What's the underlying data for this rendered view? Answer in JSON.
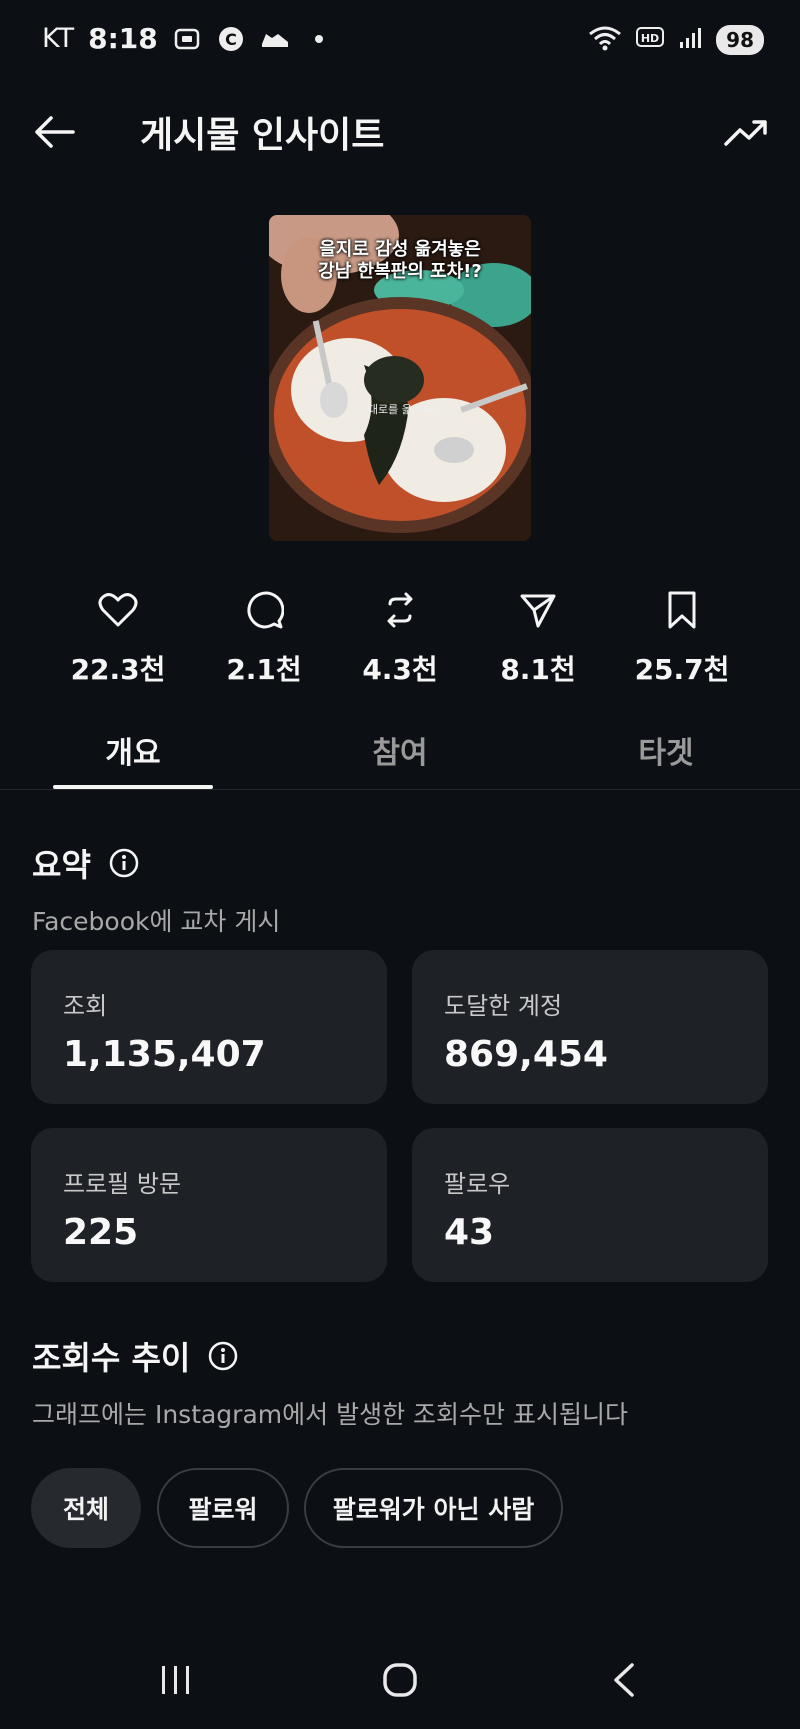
{
  "status_bar": {
    "carrier": "KT",
    "time": "8:18",
    "battery": "98",
    "icons": [
      "screenshot-icon",
      "c-icon",
      "sneaker-icon",
      "dot-icon",
      "wifi-icon",
      "hd-icon",
      "signal-icon"
    ]
  },
  "header": {
    "title": "게시물 인사이트",
    "back_icon": "arrow-left-icon",
    "trend_icon": "trending-up-icon"
  },
  "thumbnail": {
    "caption_line1": "을지로 감성 옮겨놓은",
    "caption_line2": "강남 한복판의 포차!?",
    "subtitle": "그대로를 옮겨놓은"
  },
  "metrics": [
    {
      "icon": "heart-icon",
      "value": "22.3천"
    },
    {
      "icon": "comment-icon",
      "value": "2.1천"
    },
    {
      "icon": "repost-icon",
      "value": "4.3천"
    },
    {
      "icon": "share-icon",
      "value": "8.1천"
    },
    {
      "icon": "bookmark-icon",
      "value": "25.7천"
    }
  ],
  "tabs": [
    {
      "label": "개요",
      "active": true
    },
    {
      "label": "참여",
      "active": false
    },
    {
      "label": "타겟",
      "active": false
    }
  ],
  "summary": {
    "title": "요약",
    "subtitle": "Facebook에 교차 게시",
    "cards": [
      {
        "label": "조회",
        "value": "1,135,407"
      },
      {
        "label": "도달한 계정",
        "value": "869,454"
      },
      {
        "label": "프로필 방문",
        "value": "225"
      },
      {
        "label": "팔로우",
        "value": "43"
      }
    ]
  },
  "views_trend": {
    "title": "조회수 추이",
    "subtitle": "그래프에는 Instagram에서 발생한 조회수만 표시됩니다",
    "filters": [
      {
        "label": "전체",
        "selected": true
      },
      {
        "label": "팔로워",
        "selected": false
      },
      {
        "label": "팔로워가 아닌 사람",
        "selected": false
      }
    ]
  },
  "nav_bar": {
    "icons": [
      "recent-apps-icon",
      "home-icon",
      "back-icon"
    ]
  },
  "colors": {
    "background": "#0c1014",
    "card": "#1e2227",
    "text": "#f5f5f5",
    "muted": "#a8a8a8"
  }
}
